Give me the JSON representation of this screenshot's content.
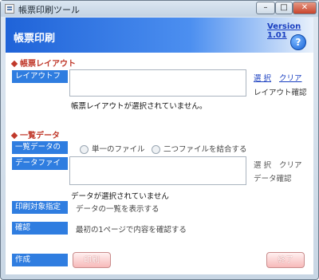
{
  "window": {
    "title": "帳票印刷ツール"
  },
  "header": {
    "title": "帳票印刷",
    "version": "Version 1.01",
    "help_icon": "?"
  },
  "layout_section": {
    "heading": "帳票レイアウト",
    "file_label": "レイアウトファイル",
    "select_link": "選 択",
    "clear_link": "クリア",
    "confirm_text": "レイアウト確認",
    "status": "帳票レイアウトが選択されていません。"
  },
  "list_section": {
    "heading": "一覧データ",
    "type_label": "一覧データの種類",
    "radio_single": "単一のファイル",
    "radio_combine": "二つファイルを結合する",
    "file_label": "データファイル",
    "select_text": "選 択",
    "clear_text": "クリア",
    "confirm_text": "データ確認",
    "status": "データが選択されていません",
    "print_target_label": "印刷対象指定",
    "print_target_text": "データの一覧を表示する",
    "confirm_label": "確認",
    "confirm_desc": "最初の1ページで内容を確認する"
  },
  "actions": {
    "create_label": "作成",
    "print_button": "印刷",
    "exit_button": "終了"
  },
  "colors": {
    "label_blue": "#2f7de0",
    "section_red": "#c0392b",
    "header_blue": "#1f63d8"
  }
}
